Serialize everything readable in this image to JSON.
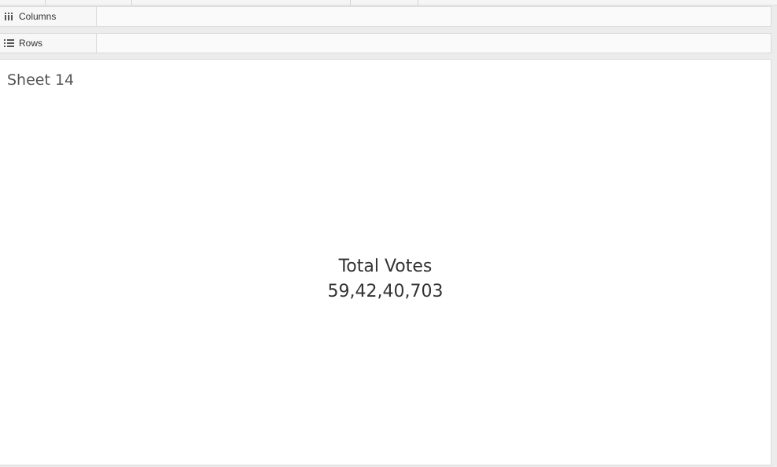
{
  "shelves": {
    "columns_label": "Columns",
    "rows_label": "Rows"
  },
  "sheet": {
    "title": "Sheet 14"
  },
  "kpi": {
    "label": "Total Votes",
    "value": "59,42,40,703"
  },
  "icons": {
    "columns": "columns-icon",
    "rows": "rows-icon"
  }
}
